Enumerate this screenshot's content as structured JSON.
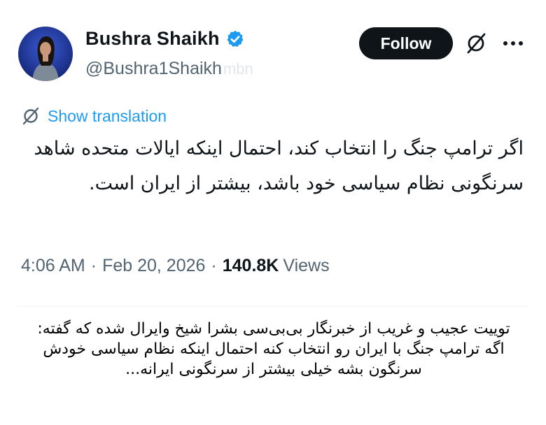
{
  "header": {
    "display_name": "Bushra Shaikh",
    "handle": "@Bushra1Shaikh",
    "watermark": "mbn",
    "follow_label": "Follow",
    "icons": {
      "verified": "verified-badge-icon",
      "grok": "grok-icon",
      "more": "more-options-icon"
    }
  },
  "tweet": {
    "translate_label": "Show translation",
    "text": "اگر ترامپ جنگ را انتخاب کند، احتمال اینکه ایالات متحده شاهد سرنگونی نظام سیاسی خود باشد، بیشتر از ایران است.",
    "time": "4:06 AM",
    "date": "Feb 20, 2026",
    "separator": "·",
    "views_count": "140.8K",
    "views_label": "Views"
  },
  "caption": {
    "line1": "توییت عجیب و غریب از خبرنگار بی‌بی‌سی بشرا شیخ وایرال شده که گفته:",
    "line2": "اگه ترامپ جنگ با ایران رو انتخاب کنه احتمال اینکه نظام سیاسی خودش سرنگون بشه خیلی بیشتر از سرنگونی ایرانه..."
  },
  "colors": {
    "accent": "#1d9bf0",
    "button_bg": "#0f1419",
    "secondary_text": "#536471"
  }
}
